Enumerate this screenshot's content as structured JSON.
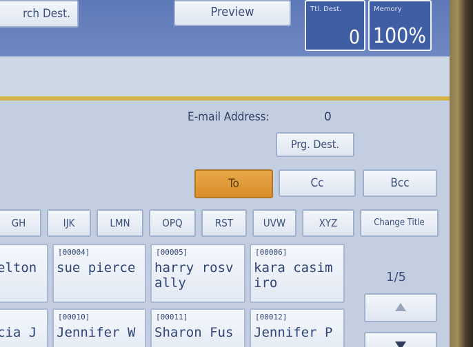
{
  "header": {
    "search_dest_label": "rch Dest.",
    "preview_label": "Preview",
    "total_dest": {
      "label": "Ttl. Dest.",
      "value": "0"
    },
    "memory": {
      "label": "Memory",
      "value": "100%"
    }
  },
  "email": {
    "label": "E-mail Address:",
    "count": "0"
  },
  "buttons": {
    "prg_dest": "Prg. Dest.",
    "to": "To",
    "cc": "Cc",
    "bcc": "Bcc",
    "change_title": "Change Title"
  },
  "tabs": [
    "GH",
    "IJK",
    "LMN",
    "OPQ",
    "RST",
    "UVW",
    "XYZ"
  ],
  "cards": [
    {
      "num": "",
      "name": "elton"
    },
    {
      "num": "[00004]",
      "name": "sue pierce"
    },
    {
      "num": "[00005]",
      "name": "harry rosv ally"
    },
    {
      "num": "[00006]",
      "name": "kara casim iro"
    },
    {
      "num": "",
      "name": "cia J"
    },
    {
      "num": "[00010]",
      "name": "Jennifer W"
    },
    {
      "num": "[00011]",
      "name": "Sharon Fus"
    },
    {
      "num": "[00012]",
      "name": "Jennifer P"
    }
  ],
  "pager": {
    "indicator": "1/5"
  }
}
